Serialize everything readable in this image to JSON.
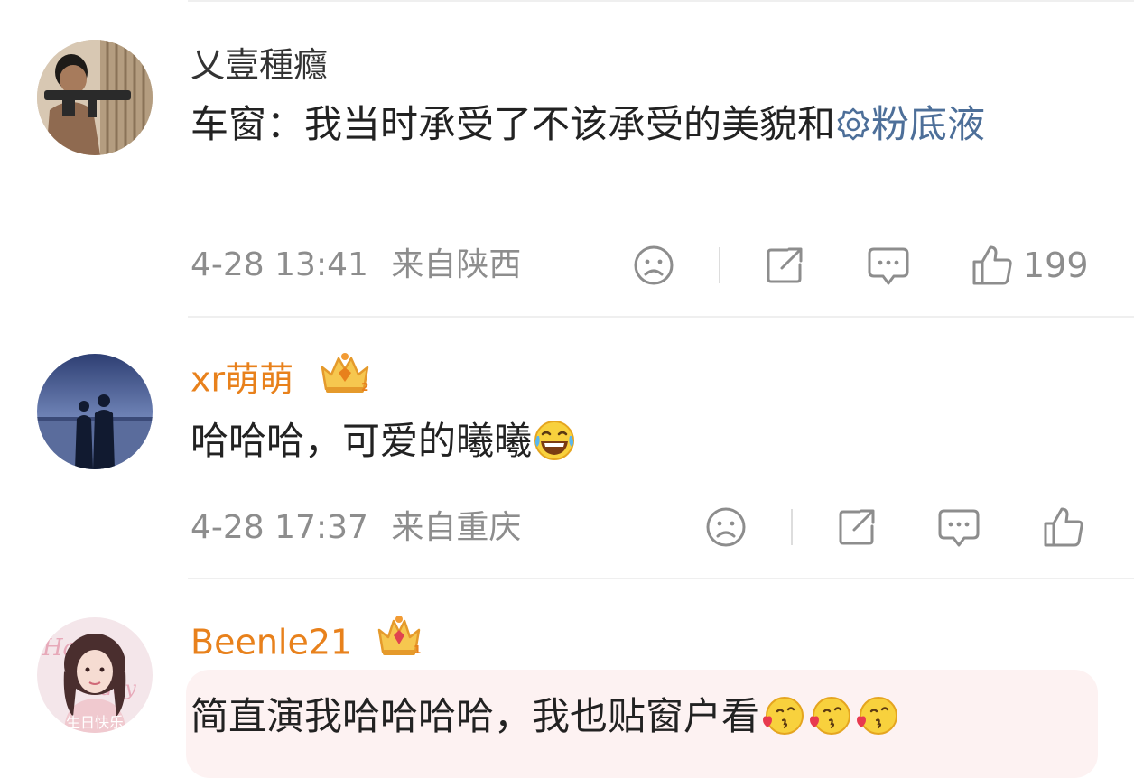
{
  "comments": [
    {
      "username": "乂壹種癮",
      "text_before": "车窗：我当时承受了不该承受的美貌和",
      "link_text": "粉底液",
      "date": "4-28 13:41",
      "location": "来自陕西",
      "like_count": "199",
      "avatar_icon": "gun-soldier-avatar"
    },
    {
      "username": "xr萌萌",
      "text": "哈哈哈，可爱的曦曦",
      "date": "4-28 17:37",
      "location": "来自重庆",
      "avatar_icon": "couple-silhouette-avatar",
      "badge_level": "2"
    },
    {
      "username": "Beenle21",
      "text": "简直演我哈哈哈哈，我也贴窗户看",
      "avatar_icon": "girl-birthday-avatar",
      "avatar_caption": "生日快乐",
      "badge_level": "1"
    }
  ],
  "colors": {
    "vip_name": "#e8811c",
    "link": "#4d6f99",
    "meta": "#8d8d8d",
    "highlight_bg": "#fdf2f2"
  }
}
